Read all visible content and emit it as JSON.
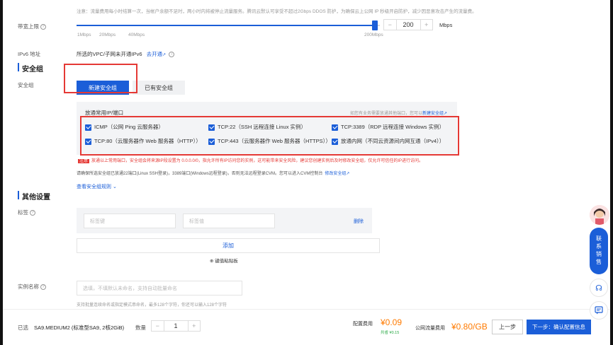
{
  "notice": "注意：流量费用每小时结算一次，当帐户余额不足时，两小时内将被停止流量服务。腾讯云默认可享受不超过2Gbps DDOS 防护，为确保云上公网 IP 秒级开启防护，减少因恶意攻击产生的流量费。",
  "bandwidth": {
    "label": "带宽上限",
    "ticks": [
      "1Mbps",
      "20Mbps",
      "40Mbps",
      "200Mbps"
    ],
    "value": "200",
    "unit": "Mbps",
    "fill_fraction": 1.0,
    "minus": "−",
    "plus": "+"
  },
  "ipv6": {
    "label": "IPv6 地址",
    "text": "所选的VPC/子网未开通IPv6",
    "link": "去开通"
  },
  "security_group": {
    "section_title": "安全组",
    "label": "安全组",
    "tabs": [
      "新建安全组",
      "已有安全组"
    ],
    "panel_title": "放通常用IP/端口",
    "panel_hint": "如您有业务需要放通其他端口，您可以",
    "panel_hint_link": "新建安全组",
    "rules": [
      "ICMP（公网 Ping 云服务器）",
      "TCP:22（SSH 远程连接 Linux 实例）",
      "TCP:3389（RDP 远程连接 Windows 实例）",
      "TCP:80（云服务器作 Web 服务器（HTTP））",
      "TCP:443（云服务器作 Web 服务器（HTTPS））",
      "放通内网（不同云资源间内网互通（IPv4））"
    ],
    "warning_tag": "注意",
    "warning_text": "放通以上常用端口，安全组会将来源IP段设置为 0.0.0.0/0，指允许所有IP访问您的实例，这可能带来安全风险，建议您创建实例后及时修改安全组，仅允许可信任的IP进行访问。",
    "info_text": "请确保所选安全组已放通22端口(Linux SSH登录)，3389端口(Windows远程登录)，否则无法远程登录CVM。您可以进入CVM控制台",
    "info_link": "修改安全组",
    "view_rules": "查看安全组规则"
  },
  "other": {
    "section_title": "其他设置",
    "tags_label": "标签",
    "tag_key_placeholder": "标签键",
    "tag_value_placeholder": "标签值",
    "delete": "删除",
    "add": "添加",
    "paste": "键值粘贴板",
    "instance_name_label": "实例名称",
    "instance_name_placeholder": "选填，不填默认未命名，支持自动批量命名",
    "instance_name_hint": "支持批量连续命名或指定模式串命名，最多128个字符，你还可以输入128个字符"
  },
  "footer": {
    "selected_label": "已选",
    "selected_value": "SA9.MEDIUM2 (标准型SA9, 2核2GiB)",
    "qty_label": "数量",
    "qty_value": "1",
    "minus": "−",
    "plus": "+",
    "config_fee_label": "配置费用",
    "config_fee": "¥0.09",
    "saved": "共省 ¥0.15",
    "traffic_fee_label": "公网流量费用",
    "traffic_fee": "¥0.80/GB",
    "prev": "上一步",
    "next": "下一步：确认配置信息"
  },
  "side": {
    "sales": "联系销售"
  },
  "colors": {
    "accent": "#1b5ed8",
    "highlight_box": "#e53935",
    "price": "#ff7a00",
    "warning": "#e53935"
  }
}
